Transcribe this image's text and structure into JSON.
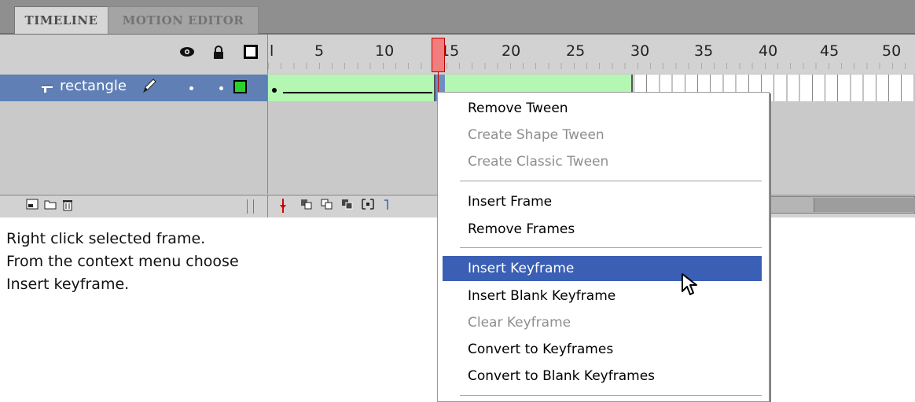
{
  "tabs": [
    {
      "label": "TIMELINE",
      "active": true
    },
    {
      "label": "MOTION EDITOR",
      "active": false
    }
  ],
  "header_icons": [
    "eye-icon",
    "lock-icon",
    "outline-icon"
  ],
  "ruler": {
    "labels": [
      "l",
      "5",
      "10",
      "15",
      "20",
      "25",
      "30",
      "35",
      "40",
      "45",
      "50"
    ],
    "current_frame": 14
  },
  "layer": {
    "name": "rectangle",
    "icons": [
      "layer-icon",
      "pencil-icon"
    ],
    "outline_color": "#2bd12b",
    "row_color": "#5f7fb5"
  },
  "tween": {
    "color": "#b3f7b3"
  },
  "footer_icons": [
    "new-layer-icon",
    "new-folder-icon",
    "delete-icon"
  ],
  "context_menu": {
    "groups": [
      [
        {
          "label": "Remove Tween",
          "enabled": true
        },
        {
          "label": "Create Shape Tween",
          "enabled": false
        },
        {
          "label": "Create Classic Tween",
          "enabled": false
        }
      ],
      [
        {
          "label": "Insert Frame",
          "enabled": true
        },
        {
          "label": "Remove Frames",
          "enabled": true
        }
      ],
      [
        {
          "label": "Insert Keyframe",
          "enabled": true,
          "highlighted": true
        },
        {
          "label": "Insert Blank Keyframe",
          "enabled": true
        },
        {
          "label": "Clear Keyframe",
          "enabled": false
        },
        {
          "label": "Convert to Keyframes",
          "enabled": true
        },
        {
          "label": "Convert to Blank Keyframes",
          "enabled": true
        }
      ]
    ],
    "highlight_color": "#3a5fb5"
  },
  "caption": {
    "line1": "Right click selected frame.",
    "line2": "From  the context menu choose",
    "line3": "Insert keyframe."
  }
}
